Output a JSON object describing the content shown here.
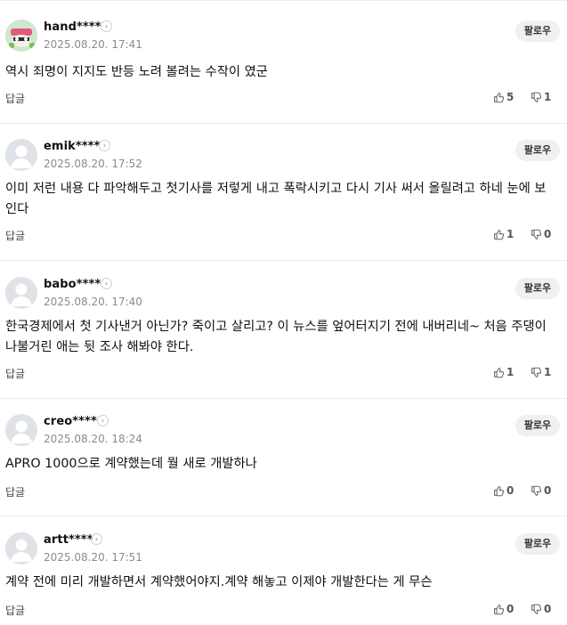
{
  "follow_label": "팔로우",
  "reply_label": "답글",
  "comments": [
    {
      "nickname": "hand****",
      "date": "2025.08.20. 17:41",
      "text": "역시 죄명이 지지도 반등 노려 볼려는 수작이 였군",
      "likes": "5",
      "dislikes": "1",
      "avatar": "illustrated-avatar"
    },
    {
      "nickname": "emik****",
      "date": "2025.08.20. 17:52",
      "text": "이미 저런 내용 다 파악해두고 첫기사를 저렇게 내고 폭락시키고 다시 기사 써서 올릴려고 하네 눈에 보인다",
      "likes": "1",
      "dislikes": "0",
      "avatar": "default-avatar"
    },
    {
      "nickname": "babo****",
      "date": "2025.08.20. 17:40",
      "text": "한국경제에서 첫 기사낸거 아닌가? 죽이고 살리고? 이 뉴스를 엎어터지기 전에 내버리네~ 처음 주댕이 나불거린 애는 뒷 조사 해봐야 한다.",
      "likes": "1",
      "dislikes": "1",
      "avatar": "default-avatar"
    },
    {
      "nickname": "creo****",
      "date": "2025.08.20. 18:24",
      "text": "APRO 1000으로 계약했는데 뭘 새로 개발하나",
      "likes": "0",
      "dislikes": "0",
      "avatar": "default-avatar"
    },
    {
      "nickname": "artt****",
      "date": "2025.08.20. 17:51",
      "text": "계약 전에 미리 개발하면서 계약했어야지.계약 해놓고 이제야 개발한다는 게 무슨",
      "likes": "0",
      "dislikes": "0",
      "avatar": "default-avatar"
    }
  ]
}
